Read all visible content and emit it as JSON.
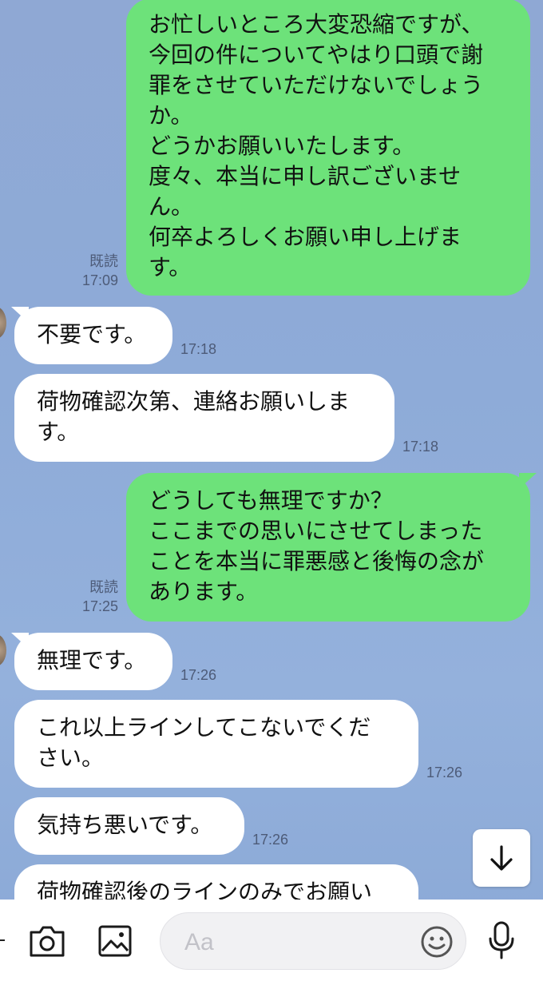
{
  "messages": [
    {
      "side": "out",
      "text": "お忙しいところ大変恐縮ですが、\n今回の件についてやはり口頭で謝\n罪をさせていただけないでしょう\nか。\nどうかお願いいたします。\n度々、本当に申し訳ございませ\nん。\n何卒よろしくお願い申し上げま\nす。",
      "read": "既読",
      "time": "17:09"
    },
    {
      "side": "in",
      "text": "不要です。",
      "time": "17:18"
    },
    {
      "side": "in",
      "text": "荷物確認次第、連絡お願いしま\nす。",
      "time": "17:18"
    },
    {
      "side": "out",
      "text": "どうしても無理ですか？\nここまでの思いにさせてしまった\nことを本当に罪悪感と後悔の念が\nあります。",
      "read": "既読",
      "time": "17:25"
    },
    {
      "side": "in",
      "text": "無理です。",
      "time": "17:26"
    },
    {
      "side": "in",
      "text": "これ以上ラインしてこないでくだ\nさい。",
      "time": "17:26"
    },
    {
      "side": "in",
      "text": "気持ち悪いです。",
      "time": "17:26"
    },
    {
      "side": "in",
      "text": "荷物確認後のラインのみでお願い",
      "time": ""
    }
  ],
  "composer": {
    "placeholder": "Aa",
    "camera_icon": "camera-icon",
    "image_icon": "image-icon",
    "emoji_icon": "emoji-icon",
    "mic_icon": "microphone-icon"
  },
  "scroll_button_icon": "arrow-down-icon",
  "colors": {
    "background": "#8eabd8",
    "outgoing_bubble": "#6de27a",
    "incoming_bubble": "#ffffff"
  }
}
